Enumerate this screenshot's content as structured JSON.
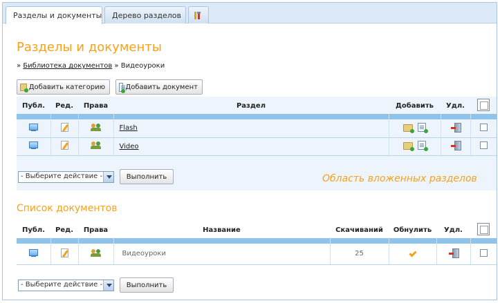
{
  "tabs": [
    {
      "label": "Разделы и документы",
      "icon": "document-icon",
      "active": true
    },
    {
      "label": "Дерево разделов",
      "icon": "tree-icon",
      "active": false
    },
    {
      "label": "",
      "icon": "tools-icon",
      "active": false
    }
  ],
  "page_title": "Разделы и документы",
  "breadcrumb": {
    "separator": "»",
    "items": [
      "Библиотека документов",
      "Видеоуроки"
    ]
  },
  "toolbar": {
    "add_category_label": "Добавить категорию",
    "add_document_label": "Добавить документ"
  },
  "sections_table": {
    "headers": {
      "pub": "Публ.",
      "edit": "Ред.",
      "rights": "Права",
      "section": "Раздел",
      "add": "Добавить",
      "del": "Удл."
    },
    "rows": [
      {
        "name": "Flash"
      },
      {
        "name": "Video"
      }
    ],
    "action_select": "- Выберите действие -",
    "execute_label": "Выполнить",
    "annotation": "Область вложенных разделов"
  },
  "documents": {
    "title": "Список документов",
    "headers": {
      "pub": "Публ.",
      "edit": "Ред.",
      "rights": "Права",
      "name": "Название",
      "downloads": "Скачиваний",
      "reset": "Обнулить",
      "del": "Удл."
    },
    "rows": [
      {
        "name": "Видеоуроки",
        "downloads": "25"
      }
    ],
    "action_select": "- Выберите действие -",
    "execute_label": "Выполнить"
  },
  "colors": {
    "accent": "#f7a21b",
    "header_band": "#8fc3ea",
    "panel_bg": "#edf4fb"
  }
}
